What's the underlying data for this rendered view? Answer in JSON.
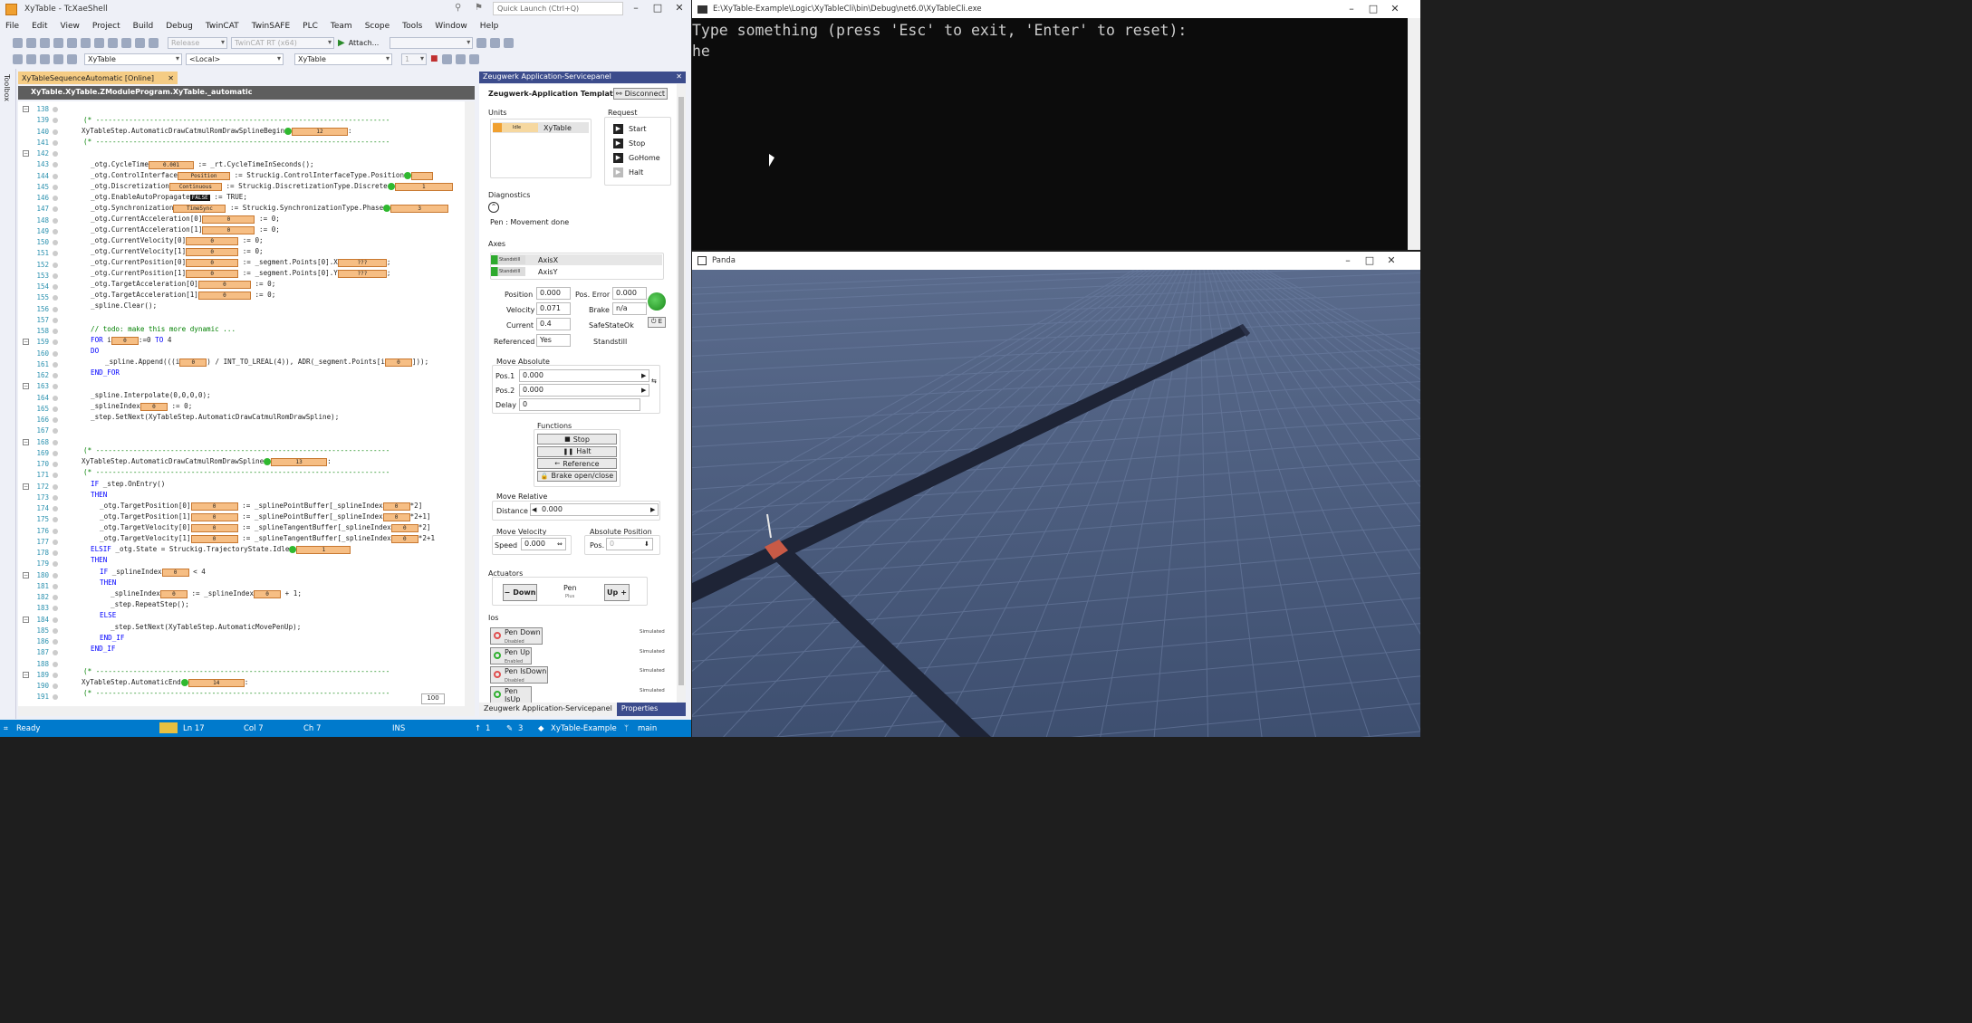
{
  "vs": {
    "title": "XyTable - TcXaeShell",
    "quick_launch": "Quick Launch (Ctrl+Q)",
    "menu": [
      "File",
      "Edit",
      "View",
      "Project",
      "Build",
      "Debug",
      "TwinCAT",
      "TwinSAFE",
      "PLC",
      "Team",
      "Scope",
      "Tools",
      "Window",
      "Help"
    ],
    "toolbar": {
      "config": "Release",
      "platform": "TwinCAT RT (x64)",
      "attach": "Attach...",
      "num": "1",
      "project_combo": "XyTable",
      "target_combo": "<Local>",
      "plc_combo": "XyTable"
    },
    "toolbox_label": "Toolbox",
    "editor_tab": "XyTableSequenceAutomatic [Online]",
    "editor_path": "XyTable.XyTable.ZModuleProgram.XyTable._automatic",
    "zoom": "100",
    "line_numbers": [
      "138",
      "139",
      "140",
      "141",
      "142",
      "143",
      "144",
      "145",
      "146",
      "147",
      "148",
      "149",
      "150",
      "151",
      "152",
      "153",
      "154",
      "155",
      "156",
      "157",
      "158",
      "159",
      "160",
      "161",
      "162",
      "163",
      "164",
      "165",
      "166",
      "167",
      "168",
      "169",
      "170",
      "171",
      "172",
      "173",
      "174",
      "175",
      "176",
      "177",
      "178",
      "179",
      "180",
      "181",
      "182",
      "183",
      "184",
      "185",
      "186",
      "187",
      "188",
      "189",
      "190",
      "191"
    ],
    "code": {
      "l139": "(* -----------------------------------------------------------------------",
      "l140a": "XyTableStep.AutomaticDrawCatmulRomDrawSplineBegin",
      "l140v": "12",
      "l141": "(* -----------------------------------------------------------------------",
      "l143a": "_otg.CycleTime",
      "l143v": "0.001",
      "l143b": " := _rt.CycleTimeInSeconds();",
      "l144a": "_otg.ControlInterface",
      "l144v": "Position",
      "l144b": " := Struckig.ControlInterfaceType.Position",
      "l145a": "_otg.Discretization",
      "l145v": "Continuous",
      "l145b": " := Struckig.DiscretizationType.Discrete",
      "l145v2": "1",
      "l146a": "_otg.EnableAutoPropagate",
      "l146v": "FALSE",
      "l146b": " := TRUE;",
      "l147a": "_otg.Synchronization",
      "l147v": "TimeSync",
      "l147b": " := Struckig.SynchronizationType.Phase",
      "l147v2": "3",
      "l148a": "_otg.CurrentAcceleration[0]",
      "l149a": "_otg.CurrentAcceleration[1]",
      "l150a": "_otg.CurrentVelocity[0]",
      "l151a": "_otg.CurrentVelocity[1]",
      "l152a": "_otg.CurrentPosition[0]",
      "l152b": " := _segment.Points[0].X",
      "l153a": "_otg.CurrentPosition[1]",
      "l153b": " := _segment.Points[0].Y",
      "unknown": "???",
      "l154a": "_otg.TargetAcceleration[0]",
      "l155a": "_otg.TargetAcceleration[1]",
      "assign0": " := 0;",
      "zero": "0",
      "one": "1",
      "l156": "_spline.Clear();",
      "l158": "// todo: make this more dynamic ...",
      "l159a": "FOR",
      "l159b": " i",
      "l159c": ":=0 ",
      "l159d": "TO",
      "l159e": " 4",
      "l160": "DO",
      "l161a": "_spline.Append(((i",
      "l161b": ") / INT_TO_LREAL(4)), ADR(_segment.Points[i",
      "l161c": "]));",
      "l162": "END_FOR",
      "l164": "_spline.Interpolate(0,0,0,0);",
      "l165a": "_splineIndex",
      "l166": "_step.SetNext(XyTableStep.AutomaticDrawCatmulRomDrawSpline);",
      "l169": "(* -----------------------------------------------------------------------",
      "l170a": "XyTableStep.AutomaticDrawCatmulRomDrawSpline",
      "l170v": "13",
      "l171": "(* -----------------------------------------------------------------------",
      "l172a": "IF",
      "l172b": " _step.OnEntry()",
      "l173": "THEN",
      "l174a": "_otg.TargetPosition[0]",
      "l174b": " := _splinePointBuffer[_splineIndex",
      "l174c": "*2]",
      "l175a": "_otg.TargetPosition[1]",
      "l175b": " := _splinePointBuffer[_splineIndex",
      "l175c": "*2+1]",
      "l176a": "_otg.TargetVelocity[0]",
      "l176b": " := _splineTangentBuffer[_splineIndex",
      "l176c": "*2]",
      "l177a": "_otg.TargetVelocity[1]",
      "l177b": " := _splineTangentBuffer[_splineIndex",
      "l177c": "*2+1",
      "l178a": "ELSIF",
      "l178b": " _otg.State = Struckig.TrajectoryState.Idle",
      "l179": "THEN",
      "l180a": "IF",
      "l180b": " _splineIndex",
      "l180c": " < 4",
      "l181": "THEN",
      "l182a": "_splineIndex",
      "l182b": " := _splineIndex",
      "l182c": " + 1;",
      "l183": "_step.RepeatStep();",
      "l184": "ELSE",
      "l185": "_step.SetNext(XyTableStep.AutomaticMovePenUp);",
      "l186": "END_IF",
      "l187": "END_IF",
      "l189": "(* -----------------------------------------------------------------------",
      "l190a": "XyTableStep.AutomaticEnd",
      "l190v": "14",
      "l191": "(* -----------------------------------------------------------------------"
    },
    "servicepanel": {
      "title": "Zeugwerk Application-Servicepanel",
      "app": "Zeugwerk-Application Template",
      "disconnect": "Disconnect",
      "units_label": "Units",
      "unit_state": "Idle",
      "unit_name": "XyTable",
      "request_label": "Request",
      "requests": [
        "Start",
        "Stop",
        "GoHome",
        "Halt"
      ],
      "diagnostics_label": "Diagnostics",
      "diagnostic_msg": "Pen : Movement done",
      "axes_label": "Axes",
      "axes": [
        {
          "state": "Standstill",
          "name": "AxisX"
        },
        {
          "state": "Standstill",
          "name": "AxisY"
        }
      ],
      "position_label": "Position",
      "position": "0.000",
      "velocity_label": "Velocity",
      "velocity": "0.071",
      "current_label": "Current",
      "current": "0.4",
      "referenced_label": "Referenced",
      "referenced": "Yes",
      "pos_error_label": "Pos. Error",
      "pos_error": "0.000",
      "brake_label": "Brake",
      "brake": "n/a",
      "safestate": "SafeStateOk",
      "standstill": "Standstill",
      "enable_glyph": "E",
      "move_abs_label": "Move Absolute",
      "pos1_label": "Pos.1",
      "pos1": "0.000",
      "pos2_label": "Pos.2",
      "pos2": "0.000",
      "delay_label": "Delay",
      "delay": "0",
      "functions_label": "Functions",
      "functions": [
        "Stop",
        "Halt",
        "Reference",
        "Brake open/close"
      ],
      "move_rel_label": "Move Relative",
      "distance_label": "Distance",
      "distance": "0.000",
      "move_vel_label": "Move Velocity",
      "speed_label": "Speed",
      "speed": "0.000",
      "abs_pos_label": "Absolute Position",
      "pos_label": "Pos.",
      "pos": "0",
      "actuators_label": "Actuators",
      "down": "Down",
      "pen": "Pen",
      "pen_sub": "Plus",
      "up": "Up",
      "ios_label": "Ios",
      "ios": [
        {
          "name": "Pen Down",
          "state": "Disabled",
          "mode": "Simulated",
          "color": "#e05050"
        },
        {
          "name": "Pen Up",
          "state": "Enabled",
          "mode": "Simulated",
          "color": "#30b030"
        },
        {
          "name": "Pen IsDown",
          "state": "Disabled",
          "mode": "Simulated",
          "color": "#e05050"
        },
        {
          "name": "Pen IsUp",
          "state": "Enabled",
          "mode": "Simulated",
          "color": "#30b030"
        }
      ],
      "tabs": [
        "Zeugwerk Application-Servicepanel",
        "Properties"
      ]
    },
    "status": {
      "ready": "Ready",
      "ln": "Ln 17",
      "col": "Col 7",
      "ch": "Ch 7",
      "ins": "INS",
      "up_count": "1",
      "edit_count": "3",
      "repo": "XyTable-Example",
      "branch": "main"
    }
  },
  "console": {
    "title": "E:\\XyTable-Example\\Logic\\XyTableCli\\bin\\Debug\\net6.0\\XyTableCli.exe",
    "line1": "Type something (press 'Esc' to exit, 'Enter' to reset):",
    "line2": "he"
  },
  "panda": {
    "title": "Panda"
  },
  "colors": {
    "accent": "#007acc",
    "online_value": "#f6be84",
    "panel_header": "#3c4c8c",
    "scene_bg": "#4a5a7a",
    "rail": "#1e2436",
    "pen": "#c85a46"
  }
}
